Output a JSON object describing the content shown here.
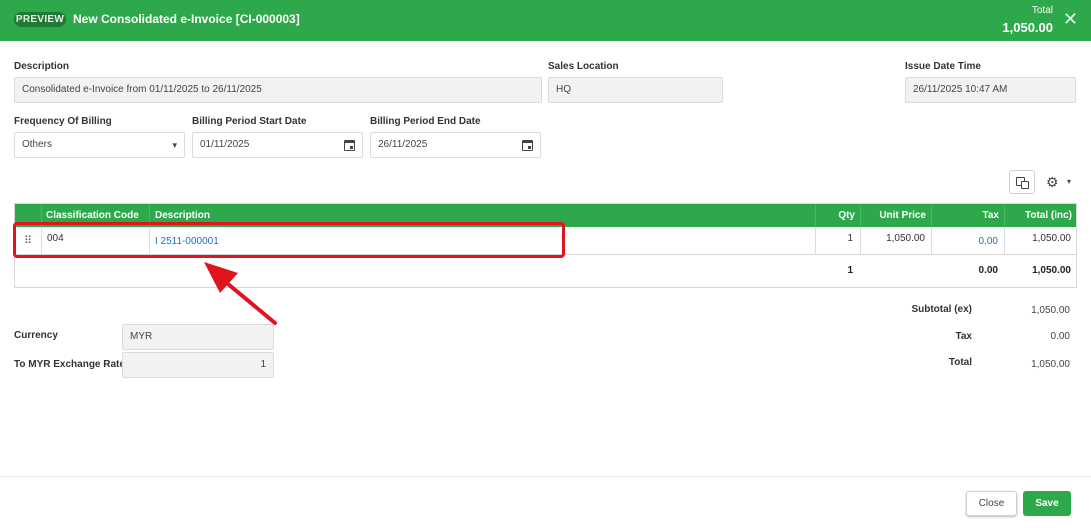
{
  "header": {
    "badge": "PREVIEW",
    "title": "New Consolidated e-Invoice [CI-000003]",
    "total_label": "Total",
    "total_value": "1,050.00",
    "close_glyph": "✕",
    "color": "#2da84a"
  },
  "form": {
    "description": {
      "label": "Description",
      "value": "Consolidated e-Invoice from 01/11/2025 to 26/11/2025"
    },
    "sales_location": {
      "label": "Sales Location",
      "value": "HQ"
    },
    "issue_date_time": {
      "label": "Issue Date Time",
      "value": "26/11/2025 10:47 AM"
    },
    "frequency_of_billing": {
      "label": "Frequency Of Billing",
      "value": "Others"
    },
    "billing_start": {
      "label": "Billing Period Start Date",
      "value": "01/11/2025"
    },
    "billing_end": {
      "label": "Billing Period End Date",
      "value": "26/11/2025"
    }
  },
  "toolbar": {
    "columns_icon": "columns-icon",
    "settings_icon": "gear-icon",
    "gear_glyph": "⚙",
    "caret_glyph": "▾"
  },
  "table": {
    "columns": [
      "Classification Code",
      "Description",
      "Qty",
      "Unit Price",
      "Tax",
      "Total (inc)"
    ],
    "rows": [
      {
        "drag": "⠿",
        "classification_code": "004",
        "description": "I 2511-000001",
        "qty": "1",
        "unit_price": "1,050.00",
        "tax": "0.00",
        "total": "1,050.00"
      }
    ],
    "totals": {
      "qty": "1",
      "tax": "0.00",
      "total": "1,050.00"
    }
  },
  "currency": {
    "label": "Currency",
    "value": "MYR"
  },
  "exchange_rate": {
    "label": "To MYR Exchange Rate",
    "value": "1"
  },
  "summary": {
    "subtotal_label": "Subtotal (ex)",
    "subtotal_value": "1,050.00",
    "tax_label": "Tax",
    "tax_value": "0.00",
    "total_label": "Total",
    "total_value": "1,050.00"
  },
  "footer": {
    "close_label": "Close",
    "save_label": "Save"
  },
  "annotation": {
    "highlight_color": "#e0141e"
  }
}
